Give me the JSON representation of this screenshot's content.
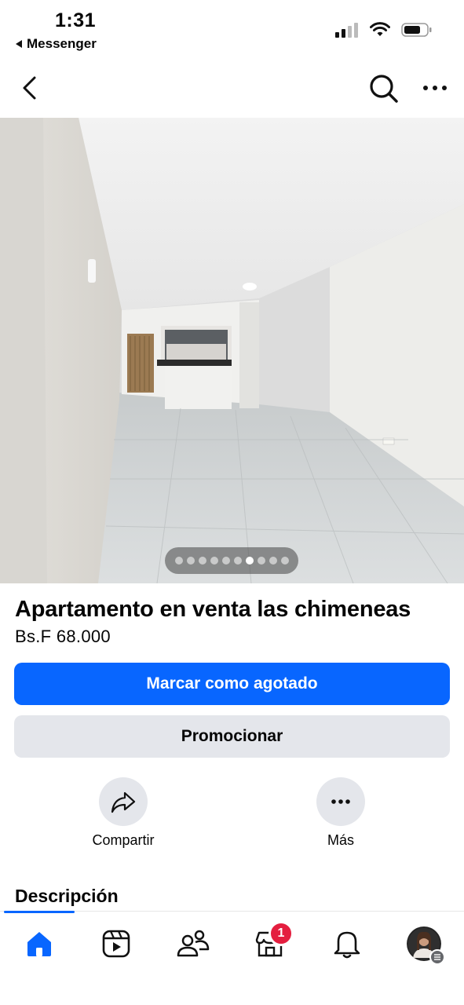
{
  "status_bar": {
    "time": "1:31",
    "back_app_label": "Messenger"
  },
  "header": {
    "back_icon": "chevron-left-icon",
    "search_icon": "search-icon",
    "more_icon": "more-horizontal-icon"
  },
  "photo": {
    "pager_count": 10,
    "pager_active_index": 6
  },
  "listing": {
    "title": "Apartamento en venta las chimeneas",
    "price": "Bs.F 68.000"
  },
  "buttons": {
    "mark_sold_label": "Marcar como agotado",
    "promote_label": "Promocionar"
  },
  "actions": {
    "share_label": "Compartir",
    "more_label": "Más"
  },
  "sections": {
    "description_title": "Descripción"
  },
  "tab_bar": {
    "tabs": [
      {
        "icon": "home-icon"
      },
      {
        "icon": "video-icon"
      },
      {
        "icon": "friends-icon"
      },
      {
        "icon": "marketplace-icon"
      },
      {
        "icon": "bell-icon"
      },
      {
        "icon": "profile-avatar"
      }
    ],
    "marketplace_badge": "1"
  },
  "colors": {
    "accent": "#0866ff",
    "secondary_button": "#e4e6eb",
    "badge": "#e41e3f"
  }
}
